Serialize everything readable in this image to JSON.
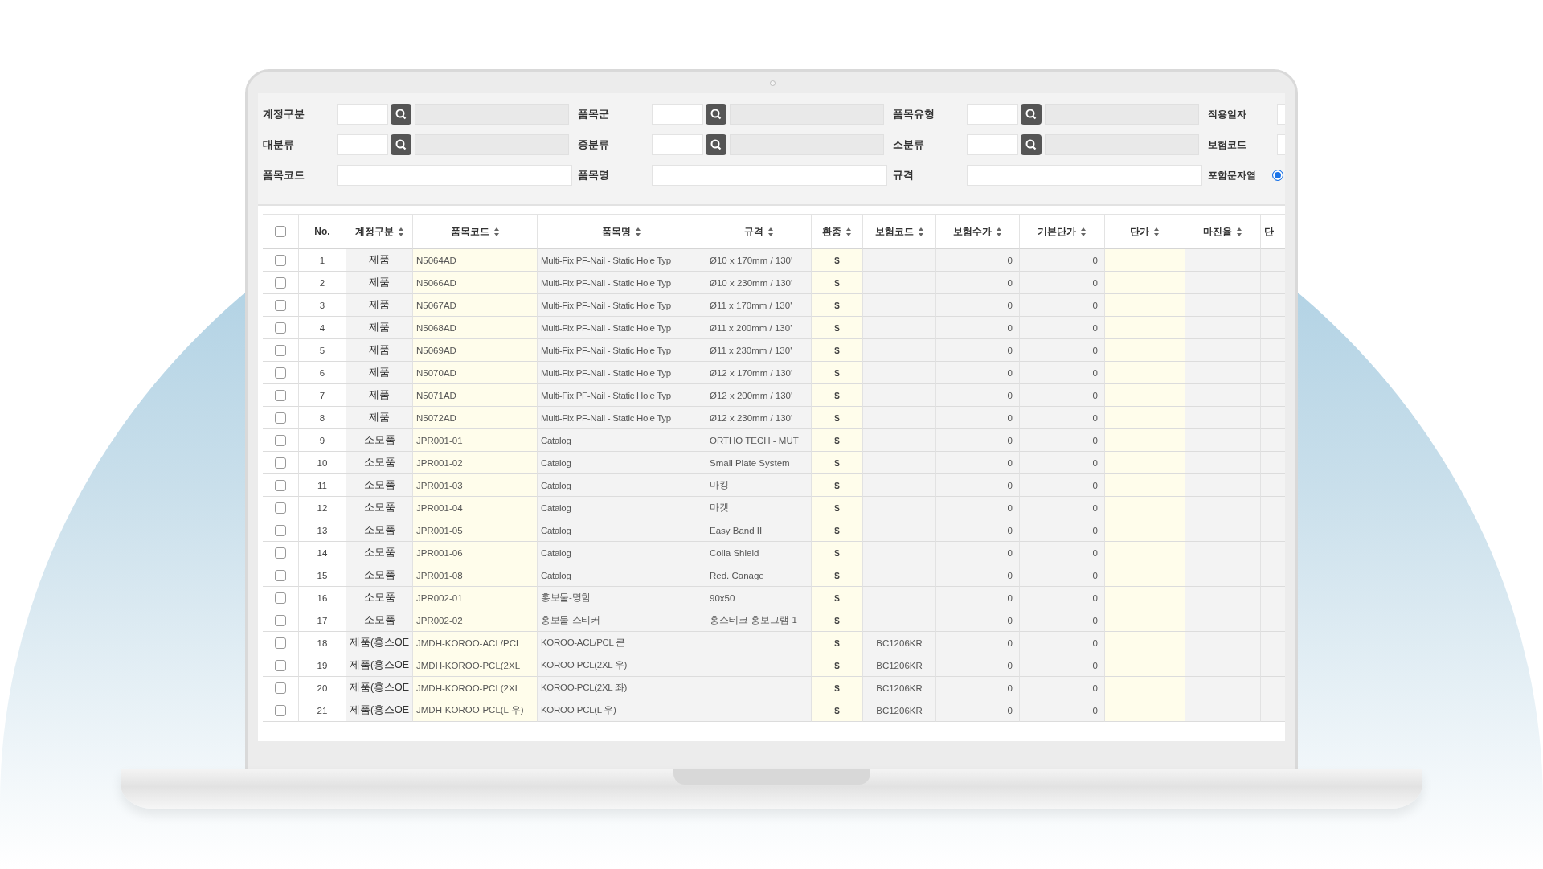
{
  "filters": [
    [
      {
        "kind": "lookup",
        "label": "계정구분"
      },
      {
        "kind": "lookup",
        "label": "품목군"
      },
      {
        "kind": "lookup",
        "label": "품목유형"
      },
      {
        "kind": "edge",
        "label": "적용일자"
      }
    ],
    [
      {
        "kind": "lookup",
        "label": "대분류"
      },
      {
        "kind": "lookup",
        "label": "중분류"
      },
      {
        "kind": "lookup",
        "label": "소분류"
      },
      {
        "kind": "edge",
        "label": "보험코드"
      }
    ],
    [
      {
        "kind": "text",
        "label": "품목코드"
      },
      {
        "kind": "text",
        "label": "품목명"
      },
      {
        "kind": "text",
        "label": "규격"
      },
      {
        "kind": "radio",
        "label": "포함문자열",
        "selected": true
      }
    ]
  ],
  "table": {
    "select_all": {
      "checked": false
    },
    "columns": [
      {
        "label": "No.",
        "sortable": false
      },
      {
        "label": "계정구분",
        "sortable": true
      },
      {
        "label": "품목코드",
        "sortable": true
      },
      {
        "label": "품목명",
        "sortable": true
      },
      {
        "label": "규격",
        "sortable": true
      },
      {
        "label": "환종",
        "sortable": true
      },
      {
        "label": "보험코드",
        "sortable": true
      },
      {
        "label": "보험수가",
        "sortable": true
      },
      {
        "label": "기본단가",
        "sortable": true
      },
      {
        "label": "단가",
        "sortable": true
      },
      {
        "label": "마진율",
        "sortable": true
      },
      {
        "label": "단",
        "sortable": false
      }
    ],
    "rows": [
      {
        "checked": false,
        "cells": [
          "1",
          "제품",
          "N5064AD",
          "Multi-Fix PF-Nail - Static Hole Typ",
          "Ø10 x 170mm / 130'",
          "$",
          null,
          "0",
          "0",
          null,
          null,
          null
        ]
      },
      {
        "checked": false,
        "cells": [
          "2",
          "제품",
          "N5066AD",
          "Multi-Fix PF-Nail - Static Hole Typ",
          "Ø10 x 230mm / 130'",
          "$",
          null,
          "0",
          "0",
          null,
          null,
          null
        ]
      },
      {
        "checked": false,
        "cells": [
          "3",
          "제품",
          "N5067AD",
          "Multi-Fix PF-Nail - Static Hole Typ",
          "Ø11 x 170mm / 130'",
          "$",
          null,
          "0",
          "0",
          null,
          null,
          null
        ]
      },
      {
        "checked": false,
        "cells": [
          "4",
          "제품",
          "N5068AD",
          "Multi-Fix PF-Nail - Static Hole Typ",
          "Ø11 x 200mm / 130'",
          "$",
          null,
          "0",
          "0",
          null,
          null,
          null
        ]
      },
      {
        "checked": false,
        "cells": [
          "5",
          "제품",
          "N5069AD",
          "Multi-Fix PF-Nail - Static Hole Typ",
          "Ø11 x 230mm / 130'",
          "$",
          null,
          "0",
          "0",
          null,
          null,
          null
        ]
      },
      {
        "checked": false,
        "cells": [
          "6",
          "제품",
          "N5070AD",
          "Multi-Fix PF-Nail - Static Hole Typ",
          "Ø12 x 170mm / 130'",
          "$",
          null,
          "0",
          "0",
          null,
          null,
          null
        ]
      },
      {
        "checked": false,
        "cells": [
          "7",
          "제품",
          "N5071AD",
          "Multi-Fix PF-Nail - Static Hole Typ",
          "Ø12 x 200mm / 130'",
          "$",
          null,
          "0",
          "0",
          null,
          null,
          null
        ]
      },
      {
        "checked": false,
        "cells": [
          "8",
          "제품",
          "N5072AD",
          "Multi-Fix PF-Nail - Static Hole Typ",
          "Ø12 x 230mm / 130'",
          "$",
          null,
          "0",
          "0",
          null,
          null,
          null
        ]
      },
      {
        "checked": false,
        "cells": [
          "9",
          "소모품",
          "JPR001-01",
          "Catalog",
          "ORTHO TECH - MUT",
          "$",
          null,
          "0",
          "0",
          null,
          null,
          null
        ]
      },
      {
        "checked": false,
        "cells": [
          "10",
          "소모품",
          "JPR001-02",
          "Catalog",
          "Small Plate System",
          "$",
          null,
          "0",
          "0",
          null,
          null,
          null
        ]
      },
      {
        "checked": false,
        "cells": [
          "11",
          "소모품",
          "JPR001-03",
          "Catalog",
          "마킹",
          "$",
          null,
          "0",
          "0",
          null,
          null,
          null
        ]
      },
      {
        "checked": false,
        "cells": [
          "12",
          "소모품",
          "JPR001-04",
          "Catalog",
          "마켓",
          "$",
          null,
          "0",
          "0",
          null,
          null,
          null
        ]
      },
      {
        "checked": false,
        "cells": [
          "13",
          "소모품",
          "JPR001-05",
          "Catalog",
          "Easy Band II",
          "$",
          null,
          "0",
          "0",
          null,
          null,
          null
        ]
      },
      {
        "checked": false,
        "cells": [
          "14",
          "소모품",
          "JPR001-06",
          "Catalog",
          "Colla Shield",
          "$",
          null,
          "0",
          "0",
          null,
          null,
          null
        ]
      },
      {
        "checked": false,
        "cells": [
          "15",
          "소모품",
          "JPR001-08",
          "Catalog",
          "Red. Canage",
          "$",
          null,
          "0",
          "0",
          null,
          null,
          null
        ]
      },
      {
        "checked": false,
        "cells": [
          "16",
          "소모품",
          "JPR002-01",
          "홍보물-명함",
          "90x50",
          "$",
          null,
          "0",
          "0",
          null,
          null,
          null
        ]
      },
      {
        "checked": false,
        "cells": [
          "17",
          "소모품",
          "JPR002-02",
          "홍보물-스티커",
          "홍스테크 홍보그램 1",
          "$",
          null,
          "0",
          "0",
          null,
          null,
          null
        ]
      },
      {
        "checked": false,
        "cells": [
          "18",
          "제품(홍스OE",
          "JMDH-KOROO-ACL/PCL",
          "KOROO-ACL/PCL 큰",
          null,
          "$",
          "BC1206KR",
          "0",
          "0",
          null,
          null,
          null
        ]
      },
      {
        "checked": false,
        "cells": [
          "19",
          "제품(홍스OE",
          "JMDH-KOROO-PCL(2XL",
          "KOROO-PCL(2XL 우)",
          null,
          "$",
          "BC1206KR",
          "0",
          "0",
          null,
          null,
          null
        ]
      },
      {
        "checked": false,
        "cells": [
          "20",
          "제품(홍스OE",
          "JMDH-KOROO-PCL(2XL",
          "KOROO-PCL(2XL 좌)",
          null,
          "$",
          "BC1206KR",
          "0",
          "0",
          null,
          null,
          null
        ]
      },
      {
        "checked": false,
        "cells": [
          "21",
          "제품(홍스OE",
          "JMDH-KOROO-PCL(L 우)",
          "KOROO-PCL(L 우)",
          null,
          "$",
          "BC1206KR",
          "0",
          "0",
          null,
          null,
          null
        ]
      }
    ]
  }
}
